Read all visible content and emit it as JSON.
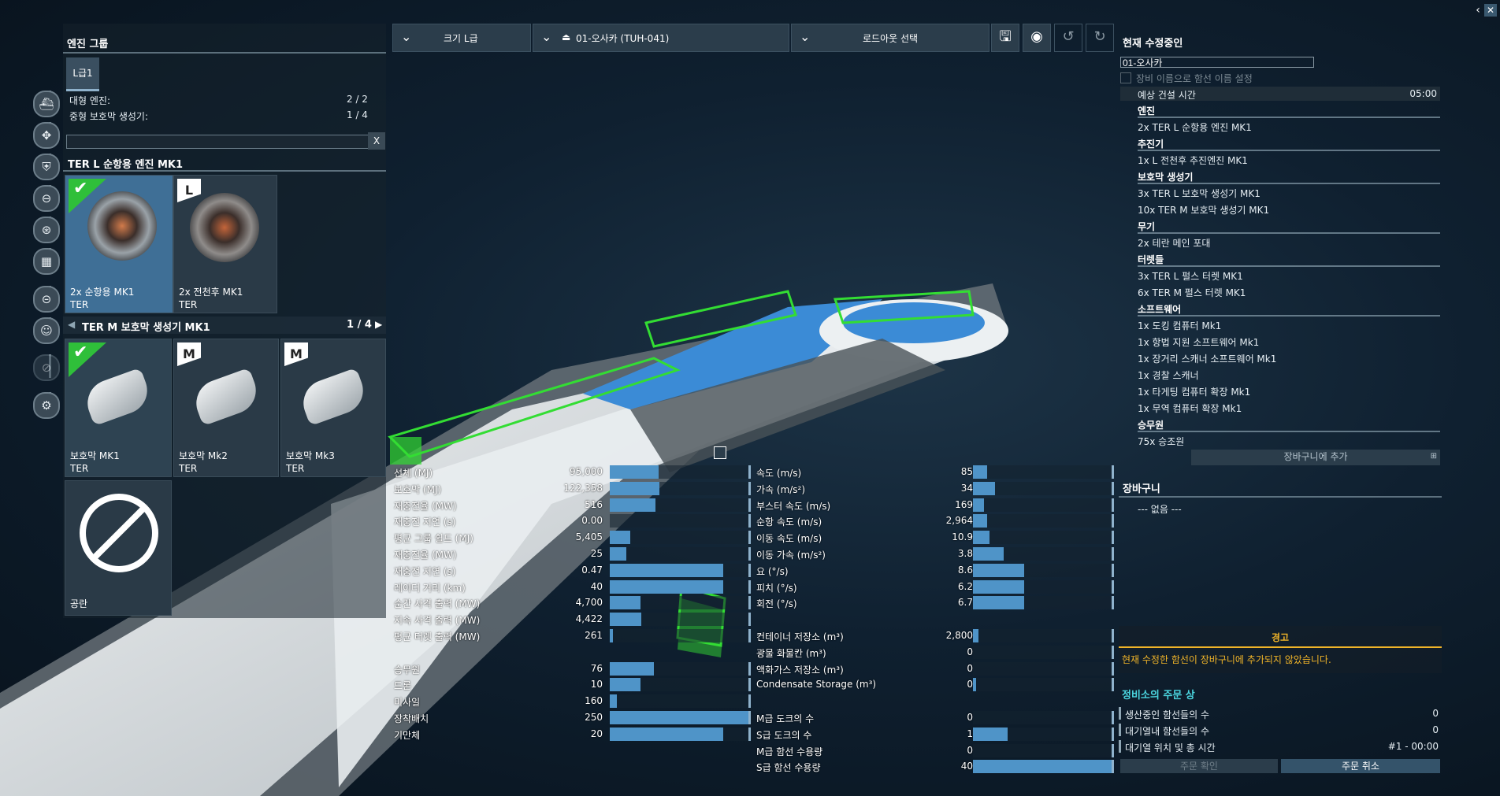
{
  "window": {
    "collapse_icon": "chevron-left-icon",
    "close_icon": "close-icon"
  },
  "left_panel": {
    "title": "엔진 그룹",
    "tab": "L급1",
    "slots": [
      {
        "label": "대형 엔진:",
        "value": "2 / 2"
      },
      {
        "label": "중형 보호막 생성기:",
        "value": "1 / 4"
      }
    ],
    "search": {
      "value": "",
      "placeholder": "",
      "clear": "X"
    },
    "engine_group": {
      "title": "TER L 순항용 엔진 MK1",
      "items": [
        {
          "name": "2x 순항용 MK1",
          "maker": "TER",
          "selected": true,
          "tag": ""
        },
        {
          "name": "2x 전천후 MK1",
          "maker": "TER",
          "selected": false,
          "tag": "L"
        }
      ]
    },
    "shield_group": {
      "title": "TER M 보호막 생성기 MK1",
      "page": "1 / 4",
      "items": [
        {
          "name": "보호막 MK1",
          "maker": "TER",
          "selected": true,
          "tag": ""
        },
        {
          "name": "보호막 Mk2",
          "maker": "TER",
          "selected": false,
          "tag": "M"
        },
        {
          "name": "보호막 Mk3",
          "maker": "TER",
          "selected": false,
          "tag": "M"
        }
      ],
      "empty": {
        "name": "공란"
      }
    },
    "side_icons": [
      "ship-class-icon",
      "movement-icon",
      "shield-icon",
      "weapon-icon",
      "turret-icon",
      "equipment-icon",
      "consumable-icon",
      "crew-icon",
      "disabled-icon",
      "settings-icon"
    ]
  },
  "toolbar": {
    "size_dropdown": "크기 L급",
    "ship_dropdown": "01-오사카 (TUH-041)",
    "loadout_dropdown": "로드아웃 선택",
    "buttons": [
      "save-icon",
      "view-icon",
      "undo-icon",
      "redo-icon"
    ]
  },
  "stats_left": [
    {
      "label": "선체 (MJ)",
      "value": "95,000",
      "frac": 0.35
    },
    {
      "label": "보호막 (MJ)",
      "value": "122,358",
      "frac": 0.36
    },
    {
      "label": "  재충전율 (MW)",
      "value": "516",
      "frac": 0.33
    },
    {
      "label": "  재충전 지연 (s)",
      "value": "0.00",
      "frac": 0.0
    },
    {
      "label": "평균 그룹 쉴드 (MJ)",
      "value": "5,405",
      "frac": 0.15
    },
    {
      "label": "  재충전율 (MW)",
      "value": "25",
      "frac": 0.12
    },
    {
      "label": "  재충전 지연 (s)",
      "value": "0.47",
      "frac": 0.82
    },
    {
      "label": "레이더 거리 (km)",
      "value": "40",
      "frac": 0.82
    },
    {
      "label": "순간 사격 출력 (MW)",
      "value": "4,700",
      "frac": 0.22
    },
    {
      "label": "지속 사격 출력 (MW)",
      "value": "4,422",
      "frac": 0.23
    },
    {
      "label": "평균 터렛 출력 (MW)",
      "value": "261",
      "frac": 0.02
    },
    {
      "label": "",
      "value": "",
      "frac": null
    },
    {
      "label": "승무원",
      "value": "76",
      "frac": 0.32
    },
    {
      "label": "드론",
      "value": "10",
      "frac": 0.22
    },
    {
      "label": "미사일",
      "value": "160",
      "frac": 0.05
    },
    {
      "label": "장착배치",
      "value": "250",
      "frac": 1.0
    },
    {
      "label": "기만체",
      "value": "20",
      "frac": 0.82
    }
  ],
  "stats_right": [
    {
      "label": "속도 (m/s)",
      "value": "85",
      "frac": 0.1
    },
    {
      "label": "가속 (m/s²)",
      "value": "34",
      "frac": 0.16
    },
    {
      "label": "부스터 속도 (m/s)",
      "value": "169",
      "frac": 0.08
    },
    {
      "label": "순항 속도 (m/s)",
      "value": "2,964",
      "frac": 0.1
    },
    {
      "label": "이동 속도 (m/s)",
      "value": "10.9",
      "frac": 0.12
    },
    {
      "label": "이동 가속 (m/s²)",
      "value": "3.8",
      "frac": 0.22
    },
    {
      "label": "요 (°/s)",
      "value": "8.6",
      "frac": 0.37
    },
    {
      "label": "피치 (°/s)",
      "value": "6.2",
      "frac": 0.37
    },
    {
      "label": "회전 (°/s)",
      "value": "6.7",
      "frac": 0.37
    },
    {
      "label": "",
      "value": "",
      "frac": null
    },
    {
      "label": "컨테이너 저장소 (m³)",
      "value": "2,800",
      "frac": 0.04
    },
    {
      "label": "광물 화물칸 (m³)",
      "value": "0",
      "frac": 0
    },
    {
      "label": "액화가스 저장소 (m³)",
      "value": "0",
      "frac": 0
    },
    {
      "label": "Condensate Storage (m³)",
      "value": "0",
      "frac": 0.01
    },
    {
      "label": "",
      "value": "",
      "frac": null
    },
    {
      "label": "M급 도크의 수",
      "value": "0",
      "frac": 0
    },
    {
      "label": "S급 도크의 수",
      "value": "1",
      "frac": 0.25
    },
    {
      "label": "M급 함선 수용량",
      "value": "0",
      "frac": 0
    },
    {
      "label": "S급 함선 수용량",
      "value": "40",
      "frac": 1.0
    }
  ],
  "right_panel": {
    "title": "현재 수정중인",
    "ship_name": "01-오사카",
    "checkbox_label": "장비 이름으로 함선 이름 설정",
    "build_time_label": "예상 건설 시간",
    "build_time": "05:00",
    "sections": [
      {
        "title": "엔진",
        "items": [
          "2x TER L 순항용 엔진 MK1"
        ]
      },
      {
        "title": "추진기",
        "items": [
          "1x L 전천후 추진엔진 MK1"
        ]
      },
      {
        "title": "보호막 생성기",
        "items": [
          "3x TER L 보호막 생성기 MK1",
          "10x TER M 보호막 생성기 MK1"
        ]
      },
      {
        "title": "무기",
        "items": [
          "2x 테란 메인 포대"
        ]
      },
      {
        "title": "터렛들",
        "items": [
          "3x TER L 펄스 터렛 MK1",
          "6x TER M 펄스 터렛 MK1"
        ]
      },
      {
        "title": "소프트웨어",
        "items": [
          "1x 도킹 컴퓨터 Mk1",
          "1x 항법 지원 소프트웨어 Mk1",
          "1x 장거리 스캐너 소프트웨어 Mk1",
          "1x 경찰 스캐너",
          "1x 타게팅 컴퓨터 확장 Mk1",
          "1x 무역 컴퓨터 확장 Mk1"
        ]
      },
      {
        "title": "승무원",
        "items": [
          "75x 승조원"
        ]
      }
    ],
    "add_to_cart": "장바구니에 추가",
    "cart_title": "장바구니",
    "cart_empty": "--- 없음 ---",
    "warning_title": "경고",
    "warning_text": "현재 수정한 함선이 장바구니에 추가되지 않았습니다.",
    "order_title": "정비소의 주문 상",
    "order_rows": [
      {
        "label": "생산중인 함선들의 수",
        "value": "0"
      },
      {
        "label": "대기열내 함선들의 수",
        "value": "0"
      },
      {
        "label": "대기열 위치 및 총 시간",
        "value": "#1 - 00:00"
      }
    ],
    "confirm_button": "주문 확인",
    "cancel_button": "주문 취소"
  },
  "colors": {
    "accent": "#4f94c8",
    "warning": "#f0b429",
    "select": "#2fbf3a"
  }
}
